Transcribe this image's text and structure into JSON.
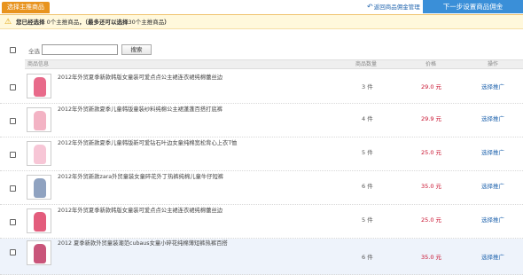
{
  "header": {
    "tab_label": "选择主推商品",
    "back_link": "返回商品佣金管理",
    "next_button": "下一步设置商品佣金"
  },
  "notice": {
    "prefix": "您已经选择",
    "count_text": "0个主推商品",
    "suffix": "，（最多还可以选择",
    "remaining_text": "30个主推商品",
    "end": "）"
  },
  "search": {
    "select_all_label": "全选",
    "input_value": "",
    "button_label": "搜索"
  },
  "table": {
    "headers": {
      "product": "商品信息",
      "quantity": "商品数量",
      "price": "价格",
      "action": "操作"
    },
    "rows": [
      {
        "title": "2012年外贸夏季新款韩版女童装可爱点点公主裙连衣裙纯棉蕾丝边",
        "quantity": "3 件",
        "price": "29.0 元",
        "action": "选择推广",
        "thumb_color": "#e86a8a"
      },
      {
        "title": "2012年外贸新款夏季儿童韩版童装纱料纯棉公主裙蓬蓬百搭打底裤",
        "quantity": "4 件",
        "price": "29.9 元",
        "action": "选择推广",
        "thumb_color": "#f3b3c4"
      },
      {
        "title": "2012年外贸新款夏季儿童韩版新可爱钻石叶边女童纯棉宽松背心上衣T恤",
        "quantity": "5 件",
        "price": "25.0 元",
        "action": "选择推广",
        "thumb_color": "#f7c6d6"
      },
      {
        "title": "2012年外贸新款zara外贸童装女童碎花外丁热裤纯棉儿童牛仔短裤",
        "quantity": "6 件",
        "price": "35.0 元",
        "action": "选择推广",
        "thumb_color": "#8fa2c0"
      },
      {
        "title": "2012年外贸夏季新款韩版女童装可爱点点公主裙连衣裙纯棉蕾丝边",
        "quantity": "5 件",
        "price": "25.0 元",
        "action": "选择推广",
        "thumb_color": "#e35c7c"
      },
      {
        "title": "2012 夏季新款外贸童装潮范cubaus女童小碎花纯棉薄短裤热裤百搭",
        "quantity": "6 件",
        "price": "35.0 元",
        "action": "选择推广",
        "thumb_color": "#c9557a"
      }
    ]
  }
}
